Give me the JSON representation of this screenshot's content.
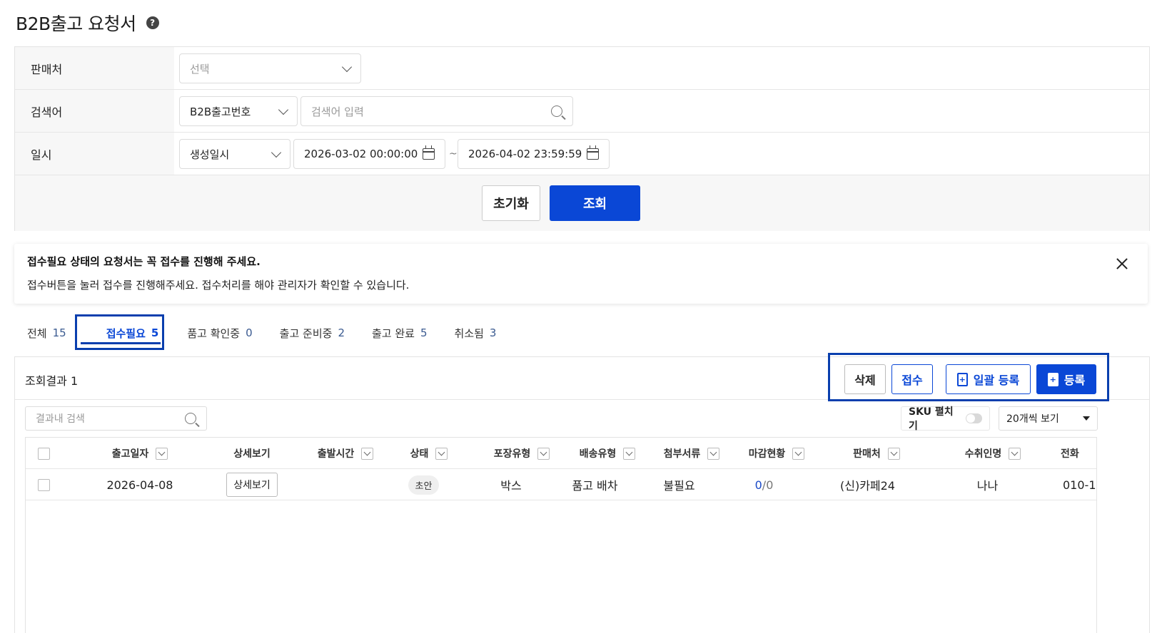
{
  "page": {
    "title": "B2B출고 요청서",
    "help_glyph": "?"
  },
  "filters": {
    "seller": {
      "label": "판매처",
      "value": "선택"
    },
    "keyword": {
      "label": "검색어",
      "type_value": "B2B출고번호",
      "placeholder": "검색어 입력"
    },
    "date": {
      "label": "일시",
      "type_value": "생성일시",
      "start": "2026-03-02 00:00:00",
      "separator": "~",
      "end": "2026-04-02 23:59:59"
    },
    "reset_label": "초기화",
    "search_label": "조회"
  },
  "notice": {
    "title": "접수필요 상태의 요청서는 꼭 접수를 진행해 주세요.",
    "body": "접수버튼을 눌러 접수를 진행해주세요. 접수처리를 해야 관리자가 확인할 수 있습니다."
  },
  "tabs": [
    {
      "label": "전체",
      "count": "15"
    },
    {
      "label": "접수필요",
      "count": "5",
      "active": true
    },
    {
      "label": "품고 확인중",
      "count": "0"
    },
    {
      "label": "출고 준비중",
      "count": "2"
    },
    {
      "label": "출고 완료",
      "count": "5"
    },
    {
      "label": "취소됨",
      "count": "3"
    }
  ],
  "results": {
    "title": "조회결과 1",
    "buttons": {
      "delete": "삭제",
      "accept": "접수",
      "bulk_register": "일괄 등록",
      "register": "등록"
    },
    "search_placeholder": "결과내 검색",
    "sku_toggle_label": "SKU 펼치기",
    "page_size": "20개씩 보기"
  },
  "table": {
    "columns": [
      "출고일자",
      "상세보기",
      "출발시간",
      "상태",
      "포장유형",
      "배송유형",
      "첨부서류",
      "마감현황",
      "판매처",
      "수취인명",
      "전화"
    ],
    "rows": [
      {
        "date": "2026-04-08",
        "detail": "상세보기",
        "depart": "",
        "status": "초안",
        "packing": "박스",
        "delivery": "품고 배차",
        "documents": "불필요",
        "deadline_done": "0",
        "deadline_total": "/0",
        "seller": "(신)카페24",
        "recipient": "나나",
        "phone": "010-1"
      }
    ]
  },
  "colors": {
    "primary": "#0a47d6",
    "highlight_border": "#0a3fae"
  }
}
